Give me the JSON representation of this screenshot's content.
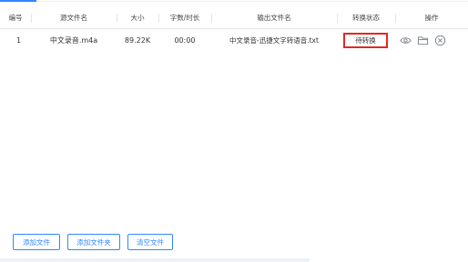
{
  "table": {
    "headers": [
      "编号",
      "源文件名",
      "大小",
      "字数/时长",
      "输出文件名",
      "转换状态",
      "操作"
    ],
    "rows": [
      {
        "index": "1",
        "source_name": "中文录音.m4a",
        "size": "89.22K",
        "duration": "00:00",
        "output_name": "中文录音-迅捷文字转语音.txt",
        "status": "待转换"
      }
    ],
    "row_actions": [
      "eye-icon",
      "folder-icon",
      "close-circle-icon"
    ]
  },
  "buttons": {
    "add_file": "添加文件",
    "add_folder": "添加文件夹",
    "clear_files": "清空文件"
  },
  "colors": {
    "accent": "#2f88ff",
    "status_outline": "#e32727"
  }
}
